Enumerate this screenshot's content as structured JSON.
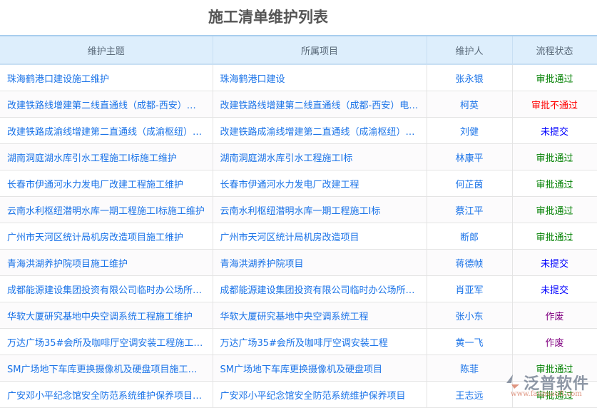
{
  "title": "施工清单维护列表",
  "colors": {
    "approved": "#008000",
    "rejected": "#ff0000",
    "unsubmitted": "#0000ff",
    "void": "#800080"
  },
  "headers": [
    "维护主题",
    "所属项目",
    "维护人",
    "流程状态"
  ],
  "rows": [
    {
      "topic": "珠海鹤港口建设施工维护",
      "project": "珠海鹤港口建设",
      "person": "张永银",
      "status": "审批通过",
      "type": "approved"
    },
    {
      "topic": "改建铁路线增建第二线直通线（成都-西安）电…",
      "project": "改建铁路线增建第二线直通线（成都-西安）电…",
      "person": "柯英",
      "status": "审批不通过",
      "type": "rejected"
    },
    {
      "topic": "改建铁路成渝线增建第二直通线（成渝枢纽）…",
      "project": "改建铁路成渝线增建第二直通线（成渝枢纽）…",
      "person": "刘健",
      "status": "未提交",
      "type": "unsubmitted"
    },
    {
      "topic": "湖南洞庭湖水库引水工程施工I标施工维护",
      "project": "湖南洞庭湖水库引水工程施工I标",
      "person": "林康平",
      "status": "审批通过",
      "type": "approved"
    },
    {
      "topic": "长春市伊通河水力发电厂改建工程施工维护",
      "project": "长春市伊通河水力发电厂改建工程",
      "person": "何芷茵",
      "status": "审批通过",
      "type": "approved"
    },
    {
      "topic": "云南水利枢纽潜明水库一期工程施工I标施工维护",
      "project": "云南水利枢纽潜明水库一期工程施工I标",
      "person": "蔡江平",
      "status": "审批通过",
      "type": "approved"
    },
    {
      "topic": "广州市天河区统计局机房改造项目施工维护",
      "project": "广州市天河区统计局机房改造项目",
      "person": "断郎",
      "status": "审批通过",
      "type": "approved"
    },
    {
      "topic": "青海洪湖养护院项目施工维护",
      "project": "青海洪湖养护院项目",
      "person": "蒋德帧",
      "status": "未提交",
      "type": "unsubmitted"
    },
    {
      "topic": "成都能源建设集团投资有限公司临时办公场所…",
      "project": "成都能源建设集团投资有限公司临时办公场所…",
      "person": "肖亚军",
      "status": "未提交",
      "type": "unsubmitted"
    },
    {
      "topic": "华软大厦研究基地中央空调系统工程施工维护",
      "project": "华软大厦研究基地中央空调系统工程",
      "person": "张小东",
      "status": "作废",
      "type": "void"
    },
    {
      "topic": "万达广场35#会所及咖啡厅空调安装工程施工…",
      "project": "万达广场35#会所及咖啡厅空调安装工程",
      "person": "黄一飞",
      "status": "作废",
      "type": "void"
    },
    {
      "topic": "SM广场地下车库更换摄像机及硬盘项目施工…",
      "project": "SM广场地下车库更换摄像机及硬盘项目",
      "person": "陈菲",
      "status": "审批通过",
      "type": "approved"
    },
    {
      "topic": "广安邓小平纪念馆安全防范系统维护保养项目…",
      "project": "广安邓小平纪念馆安全防范系统维护保养项目",
      "person": "王志远",
      "status": "审批通过",
      "type": "approved"
    }
  ],
  "watermark": {
    "name": "泛普软件",
    "url": "www.fanpusoft.com"
  }
}
